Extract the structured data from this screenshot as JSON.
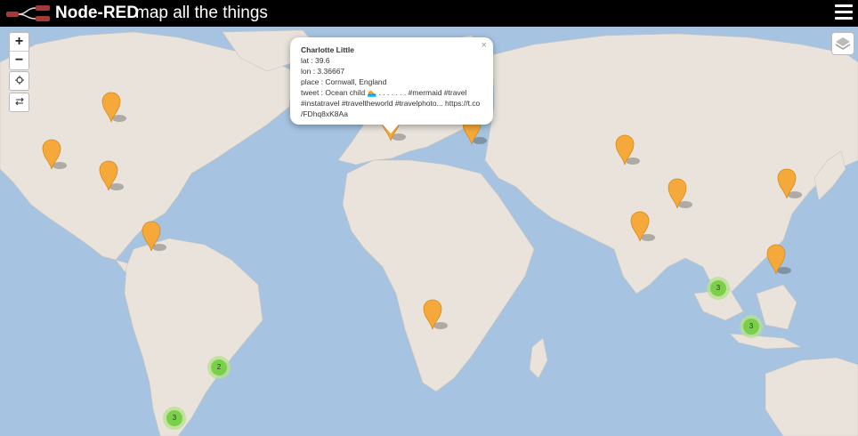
{
  "header": {
    "brand": "Node-RED",
    "subtitle": "map all the things",
    "logo_icon": "node-red-logo",
    "menu_icon": "hamburger-menu-icon"
  },
  "colors": {
    "header_bg": "#000000",
    "ocean": "#a6c4e1",
    "land": "#e9e3dc",
    "marker": "#f4a93a",
    "cluster_outer": "#b5e28c",
    "cluster_inner": "#6ecc39"
  },
  "map_controls": {
    "zoom_in": "+",
    "zoom_out": "−",
    "locate_icon": "crosshair-icon",
    "swap_icon": "swap-arrows-icon",
    "layers_icon": "layers-icon"
  },
  "popup": {
    "name": "Charlotte Little",
    "lat": "lat : 39.6",
    "lon": "lon : 3.36667",
    "place": "place : Cornwall, England",
    "tweet_1": "tweet : Ocean child 🏊 . . . . . . . #mermaid #travel",
    "tweet_2": "#instatravel #traveltheworld #travelphoto... https://t.co",
    "tweet_3": "/FDhq8xK8Aa",
    "close": "×"
  },
  "markers": [
    {
      "id": "canada-east"
    },
    {
      "id": "us-west"
    },
    {
      "id": "us-southeast"
    },
    {
      "id": "venezuela"
    },
    {
      "id": "balearic"
    },
    {
      "id": "turkey"
    },
    {
      "id": "angola"
    },
    {
      "id": "nepal"
    },
    {
      "id": "india-central"
    },
    {
      "id": "bangladesh"
    },
    {
      "id": "china-east"
    },
    {
      "id": "borneo"
    }
  ],
  "clusters": [
    {
      "count": "3"
    },
    {
      "count": "3"
    },
    {
      "count": "2"
    },
    {
      "count": "3"
    }
  ]
}
